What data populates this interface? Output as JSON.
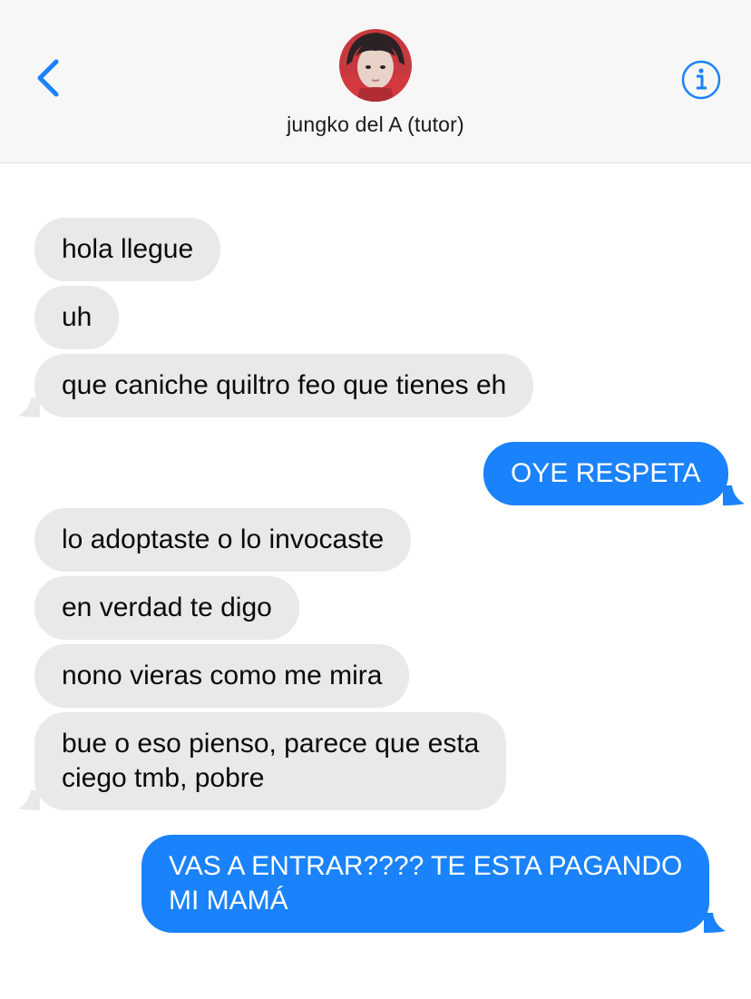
{
  "header": {
    "contact_name": "jungko del A (tutor)",
    "back_icon": "chevron-left-icon",
    "info_icon": "info-icon"
  },
  "colors": {
    "accent": "#1a82fb",
    "incoming_bubble": "#e9e9eb",
    "header_bg": "#f7f7f7"
  },
  "messages": [
    {
      "direction": "incoming",
      "text": "hola llegue"
    },
    {
      "direction": "incoming",
      "text": "uh"
    },
    {
      "direction": "incoming",
      "text": "que caniche quiltro feo que tienes eh"
    },
    {
      "direction": "outgoing",
      "text": "OYE RESPETA"
    },
    {
      "direction": "incoming",
      "text": "lo adoptaste o lo invocaste"
    },
    {
      "direction": "incoming",
      "text": "en verdad te digo"
    },
    {
      "direction": "incoming",
      "text": "nono vieras como me mira"
    },
    {
      "direction": "incoming",
      "lines": [
        "bue o eso pienso, parece que esta",
        "ciego tmb, pobre"
      ]
    },
    {
      "direction": "outgoing",
      "lines": [
        "VAS A ENTRAR???? TE ESTA PAGANDO",
        "MI MAMÁ"
      ]
    }
  ]
}
